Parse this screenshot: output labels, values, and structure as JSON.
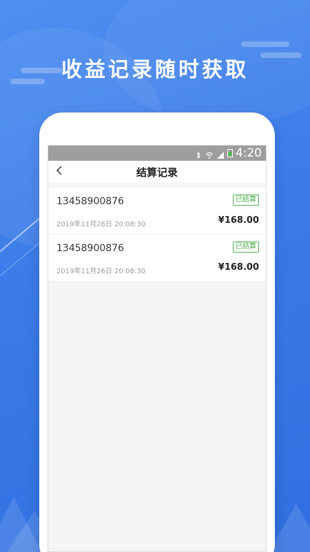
{
  "headline": "收益记录随时获取",
  "status_bar": {
    "time": "4:20",
    "icons": [
      "bluetooth-icon",
      "wifi-icon",
      "signal-icon",
      "battery-icon"
    ]
  },
  "nav": {
    "back_icon": "chevron-left-icon",
    "title": "结算记录"
  },
  "records": [
    {
      "phone": "13458900876",
      "status": "已结算",
      "date": "2019年11月26日 20:08:30",
      "amount": "¥168.00"
    },
    {
      "phone": "13458900876",
      "status": "已结算",
      "date": "2019年11月26日 20:08:30",
      "amount": "¥168.00"
    }
  ],
  "colors": {
    "background": "#3b7be8",
    "status_badge": "#4cae4c",
    "battery": "#38c338"
  }
}
